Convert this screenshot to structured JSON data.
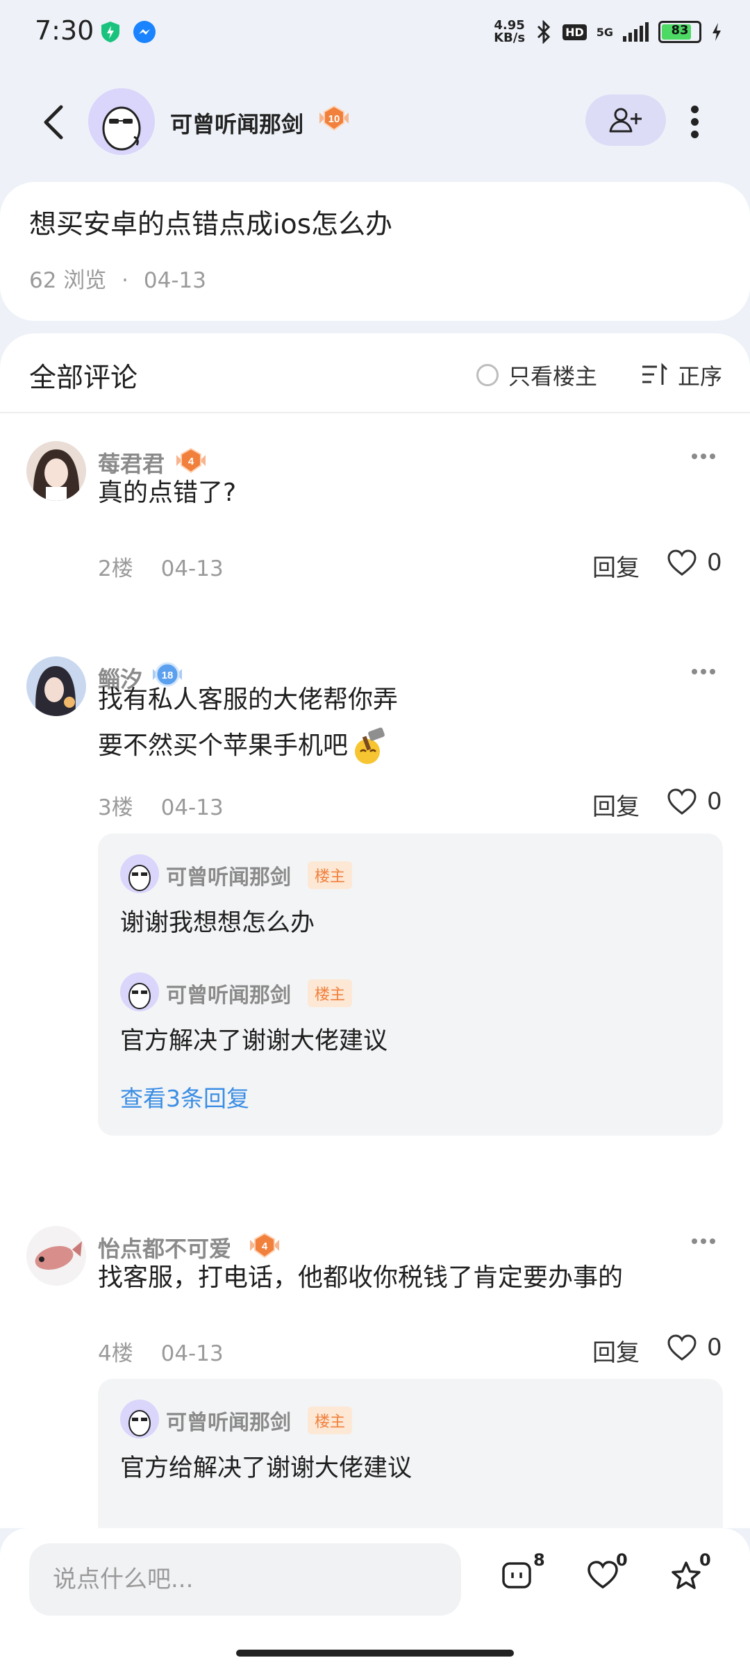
{
  "status_bar": {
    "time": "7:30",
    "net_speed_top": "4.95",
    "net_speed_bottom": "KB/s",
    "bluetooth_icon": "bluetooth-icon",
    "hd_label": "HD",
    "network_label": "5G",
    "battery_percent": "83",
    "battery_level": 0.83
  },
  "header": {
    "author_name": "可曾听闻那剑",
    "author_level": "10"
  },
  "post": {
    "title": "想买安卓的点错点成ios怎么办",
    "views": "62 浏览",
    "separator": "·",
    "date": "04-13"
  },
  "comments_panel": {
    "title": "全部评论",
    "only_owner_label": "只看楼主",
    "sort_label": "正序"
  },
  "comments": [
    {
      "name": "莓君君",
      "level": "4",
      "lines": [
        "真的点错了?"
      ],
      "floor": "2楼",
      "date": "04-13",
      "reply_label": "回复",
      "likes": "0"
    },
    {
      "name": "鲻汐",
      "level": "18",
      "lines": [
        "找有私人客服的大佬帮你弄",
        "要不然买个苹果手机吧"
      ],
      "floor": "3楼",
      "date": "04-13",
      "reply_label": "回复",
      "likes": "0",
      "replies": [
        {
          "name": "可曾听闻那剑",
          "tag": "楼主",
          "text": "谢谢我想想怎么办"
        },
        {
          "name": "可曾听闻那剑",
          "tag": "楼主",
          "text": "官方解决了谢谢大佬建议"
        }
      ],
      "view_more": "查看3条回复"
    },
    {
      "name": "怡点都不可爱",
      "level": "4",
      "lines": [
        "找客服，打电话，他都收你税钱了肯定要办事的"
      ],
      "floor": "4楼",
      "date": "04-13",
      "reply_label": "回复",
      "likes": "0",
      "replies": [
        {
          "name": "可曾听闻那剑",
          "tag": "楼主",
          "text": "官方给解决了谢谢大佬建议"
        }
      ]
    }
  ],
  "bottom_bar": {
    "input_placeholder": "说点什么吧...",
    "comment_count": "8",
    "like_count": "0",
    "favorite_count": "0"
  },
  "colors": {
    "background": "#eef2f8",
    "follow_button": "#dcdcf7",
    "link": "#3b8ee4",
    "owner_tag_text": "#f0803c",
    "owner_tag_bg": "#fde8d6",
    "level_badge": "#f0803c",
    "level_badge_blue": "#5aa0ee"
  }
}
